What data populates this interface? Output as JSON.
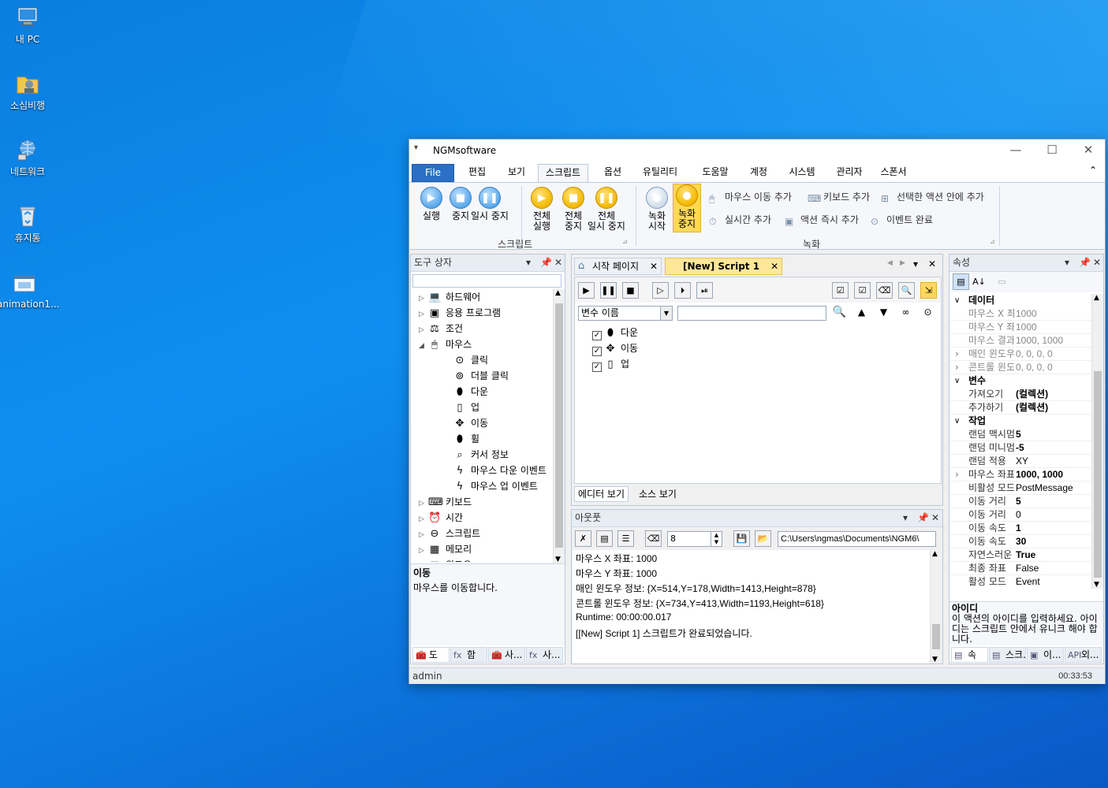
{
  "desktop": {
    "icons": [
      {
        "label": "내 PC",
        "icon": "computer-icon"
      },
      {
        "label": "소심비행",
        "icon": "user-folder-icon"
      },
      {
        "label": "네트워크",
        "icon": "network-icon"
      },
      {
        "label": "휴지통",
        "icon": "recycle-bin-icon"
      },
      {
        "label": "animation1...",
        "icon": "app-shortcut-icon"
      }
    ]
  },
  "window": {
    "title": "NGMsoftware",
    "quick_access": "▾",
    "controls": {
      "minimize": "—",
      "maximize": "☐",
      "close": "✕"
    }
  },
  "menu": {
    "tabs": [
      "File",
      "편집",
      "보기",
      "스크립트",
      "옵션",
      "유틸리티",
      "도움말",
      "계정",
      "시스템",
      "관리자",
      "스폰서"
    ],
    "active": "스크립트",
    "collapse": "⌃"
  },
  "ribbon": {
    "script_group": {
      "label": "스크립트",
      "buttons": [
        {
          "label1": "실행",
          "label2": "",
          "glyph": "▶",
          "style": "blue"
        },
        {
          "label1": "중지",
          "label2": "",
          "glyph": "■",
          "style": "blue"
        },
        {
          "label1": "일시 중지",
          "label2": "",
          "glyph": "❚❚",
          "style": "blue"
        },
        {
          "label1": "전체",
          "label2": "실행",
          "glyph": "▶",
          "style": "yellow"
        },
        {
          "label1": "전체",
          "label2": "중지",
          "glyph": "■",
          "style": "yellow"
        },
        {
          "label1": "전체",
          "label2": "일시 중지",
          "glyph": "❚❚",
          "style": "yellow"
        }
      ]
    },
    "record_group": {
      "label": "녹화",
      "buttons": [
        {
          "label1": "녹화",
          "label2": "시작",
          "glyph": "●",
          "style": "gray"
        },
        {
          "label1": "녹화",
          "label2": "중지",
          "glyph": "●",
          "style": "yellow"
        }
      ],
      "small": [
        {
          "label": "마우스 이동 추가",
          "icon": "mouse-icon"
        },
        {
          "label": "키보드 추가",
          "icon": "keyboard-icon"
        },
        {
          "label": "선택한 액션 안에 추가",
          "icon": "tree-add-icon"
        },
        {
          "label": "실시간 추가",
          "icon": "clock-icon"
        },
        {
          "label": "액션 즉시 추가",
          "icon": "window-add-icon"
        },
        {
          "label": "이벤트 완료",
          "icon": "event-icon"
        }
      ]
    }
  },
  "toolbox": {
    "title": "도구 상자",
    "search_value": "",
    "items": [
      {
        "label": "하드웨어",
        "indent": 0,
        "arrow": "▷",
        "icon": "💻"
      },
      {
        "label": "응용 프로그램",
        "indent": 0,
        "arrow": "▷",
        "icon": "▣"
      },
      {
        "label": "조건",
        "indent": 0,
        "arrow": "▷",
        "icon": "⚖"
      },
      {
        "label": "마우스",
        "indent": 0,
        "arrow": "◢",
        "icon": "🖱"
      },
      {
        "label": "클릭",
        "indent": 1,
        "arrow": "",
        "icon": "⊙"
      },
      {
        "label": "더블 클릭",
        "indent": 1,
        "arrow": "",
        "icon": "⊚"
      },
      {
        "label": "다운",
        "indent": 1,
        "arrow": "",
        "icon": "⬮"
      },
      {
        "label": "업",
        "indent": 1,
        "arrow": "",
        "icon": "▯"
      },
      {
        "label": "이동",
        "indent": 1,
        "arrow": "",
        "icon": "✥"
      },
      {
        "label": "휠",
        "indent": 1,
        "arrow": "",
        "icon": "⬮"
      },
      {
        "label": "커서 정보",
        "indent": 1,
        "arrow": "",
        "icon": "⌕"
      },
      {
        "label": "마우스 다운 이벤트",
        "indent": 1,
        "arrow": "",
        "icon": "ϟ"
      },
      {
        "label": "마우스 업 이벤트",
        "indent": 1,
        "arrow": "",
        "icon": "ϟ"
      },
      {
        "label": "키보드",
        "indent": 0,
        "arrow": "▷",
        "icon": "⌨"
      },
      {
        "label": "시간",
        "indent": 0,
        "arrow": "▷",
        "icon": "⏰"
      },
      {
        "label": "스크립트",
        "indent": 0,
        "arrow": "▷",
        "icon": "⊖"
      },
      {
        "label": "메모리",
        "indent": 0,
        "arrow": "▷",
        "icon": "▦"
      },
      {
        "label": "윈도우",
        "indent": 0,
        "arrow": "▷",
        "icon": "▤"
      }
    ],
    "desc_title": "이동",
    "desc_text": "마우스를 이동합니다.",
    "bottom_tabs": [
      {
        "label": "도",
        "icon": "🧰"
      },
      {
        "label": "함",
        "icon": "fx"
      },
      {
        "label": "사...",
        "icon": "🧰"
      },
      {
        "label": "사...",
        "icon": "fx"
      }
    ]
  },
  "editor": {
    "tabs": [
      {
        "label": "시작 페이지",
        "active": false
      },
      {
        "label": "[New] Script 1",
        "active": true
      }
    ],
    "nav": {
      "prev": "◀",
      "next": "▶",
      "menu": "▾",
      "close": "✕"
    },
    "toolbar_left": [
      "▶",
      "❚❚",
      "■",
      "▷",
      "⏵",
      "⏯"
    ],
    "toolbar_right": [
      "☑",
      "☑",
      "⌫",
      "🔍",
      "⇲"
    ],
    "var_select": "변수 이름",
    "search_value": "",
    "search_buttons": [
      "🔍",
      "▲",
      "▼",
      "∞",
      "⊙"
    ],
    "actions": [
      {
        "label": "다운",
        "icon": "⬮"
      },
      {
        "label": "이동",
        "icon": "✥"
      },
      {
        "label": "업",
        "icon": "▯"
      }
    ],
    "view_tabs": [
      "에디터 보기",
      "소스 보기"
    ]
  },
  "output": {
    "title": "아웃풋",
    "count": "8",
    "path": "C:\\Users\\ngmas\\Documents\\NGM6\\",
    "lines": [
      "마우스 X 좌표: 1000",
      "마우스 Y 좌표: 1000",
      "매인 윈도우 정보: {X=514,Y=178,Width=1413,Height=878}",
      "콘트롤 윈도우 정보: {X=734,Y=413,Width=1193,Height=618}",
      "Runtime: 00:00:00.017",
      "[[New] Script 1] 스크립트가 완료되었습니다."
    ]
  },
  "properties": {
    "title": "속성",
    "rows": [
      {
        "type": "cat",
        "name": "데이터"
      },
      {
        "type": "prop",
        "name": "마우스 X 좌",
        "value": "1000",
        "dim": true
      },
      {
        "type": "prop",
        "name": "마우스 Y 좌",
        "value": "1000",
        "dim": true
      },
      {
        "type": "prop",
        "name": "마우스 결과",
        "value": "1000, 1000",
        "dim": true
      },
      {
        "type": "prop",
        "name": "매인 윈도우",
        "value": "0, 0, 0, 0",
        "dim": true,
        "exp": true
      },
      {
        "type": "prop",
        "name": "콘트롤 윈도",
        "value": "0, 0, 0, 0",
        "dim": true,
        "exp": true
      },
      {
        "type": "cat",
        "name": "변수"
      },
      {
        "type": "prop",
        "name": "가져오기",
        "value": "(컬렉션)",
        "bold": true
      },
      {
        "type": "prop",
        "name": "추가하기",
        "value": "(컬렉션)",
        "bold": true
      },
      {
        "type": "cat",
        "name": "작업"
      },
      {
        "type": "prop",
        "name": "랜덤 맥시멈",
        "value": "5",
        "bold": true
      },
      {
        "type": "prop",
        "name": "랜덤 미니멈",
        "value": "-5",
        "bold": true
      },
      {
        "type": "prop",
        "name": "랜덤 적용",
        "value": "XY"
      },
      {
        "type": "prop",
        "name": "마우스 좌표",
        "value": "1000, 1000",
        "bold": true,
        "exp": true
      },
      {
        "type": "prop",
        "name": "비활성 모드",
        "value": "PostMessage"
      },
      {
        "type": "prop",
        "name": "이동 거리",
        "value": "5",
        "bold": true
      },
      {
        "type": "prop",
        "name": "이동 거리",
        "value": "0"
      },
      {
        "type": "prop",
        "name": "이동 속도",
        "value": "1",
        "bold": true
      },
      {
        "type": "prop",
        "name": "이동 속도",
        "value": "30",
        "bold": true
      },
      {
        "type": "prop",
        "name": "자연스러운",
        "value": "True",
        "bold": true
      },
      {
        "type": "prop",
        "name": "최종 좌표",
        "value": "False"
      },
      {
        "type": "prop",
        "name": "활성 모드",
        "value": "Event"
      }
    ],
    "desc_title": "아이디",
    "desc_text": "이 액션의 아이디를 입력하세요. 아이디는 스크립트 안에서 유니크 해야 합니다.",
    "bottom_tabs": [
      {
        "label": "속",
        "icon": "▤"
      },
      {
        "label": "스크...",
        "icon": "▤"
      },
      {
        "label": "이...",
        "icon": "▣"
      },
      {
        "label": "외...",
        "icon": "API"
      }
    ]
  },
  "status": {
    "user": "admin",
    "time": "00:33:53"
  }
}
